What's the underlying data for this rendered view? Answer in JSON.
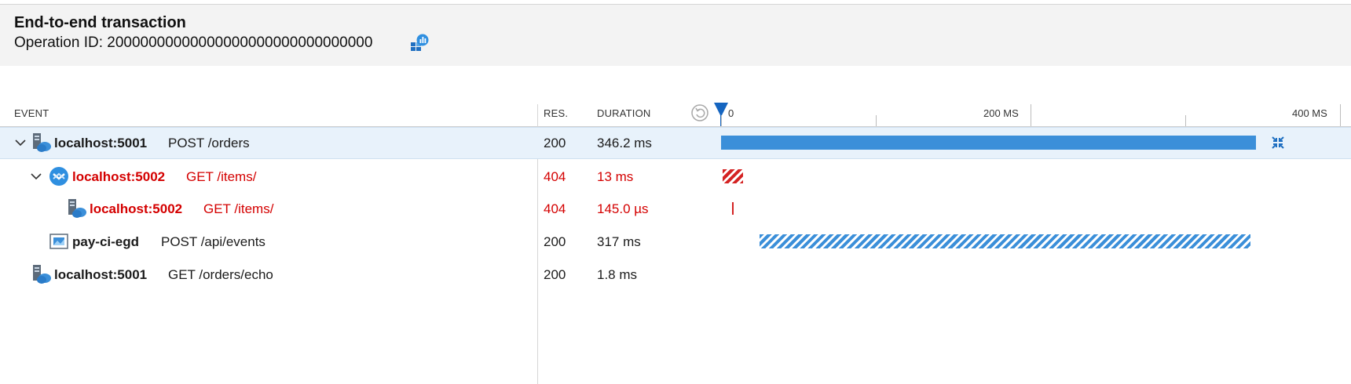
{
  "header": {
    "title": "End-to-end transaction",
    "operation_id": "Operation ID: 20000000000000000000000000000000"
  },
  "columns": {
    "event": "EVENT",
    "res": "RES.",
    "duration": "DURATION"
  },
  "timeline": {
    "ticks": [
      "0",
      "200 MS",
      "400 MS"
    ],
    "bar_color": "#3b8fd9",
    "error_color": "#d42222"
  },
  "rows": [
    {
      "host": "localhost:5001",
      "operation": "POST /orders",
      "res": "200",
      "duration": "346.2 ms",
      "error": false,
      "selected": true,
      "icon": "app-server-icon",
      "expanded": true
    },
    {
      "host": "localhost:5002",
      "operation": "GET /items/",
      "res": "404",
      "duration": "13 ms",
      "error": true,
      "icon": "service-bus-icon",
      "expanded": true
    },
    {
      "host": "localhost:5002",
      "operation": "GET /items/",
      "res": "404",
      "duration": "145.0 µs",
      "error": true,
      "icon": "app-server-icon"
    },
    {
      "host": "pay-ci-egd",
      "operation": "POST /api/events",
      "res": "200",
      "duration": "317 ms",
      "error": false,
      "icon": "event-grid-icon"
    },
    {
      "host": "localhost:5001",
      "operation": "GET /orders/echo",
      "res": "200",
      "duration": "1.8 ms",
      "error": false,
      "icon": "app-server-icon"
    }
  ]
}
